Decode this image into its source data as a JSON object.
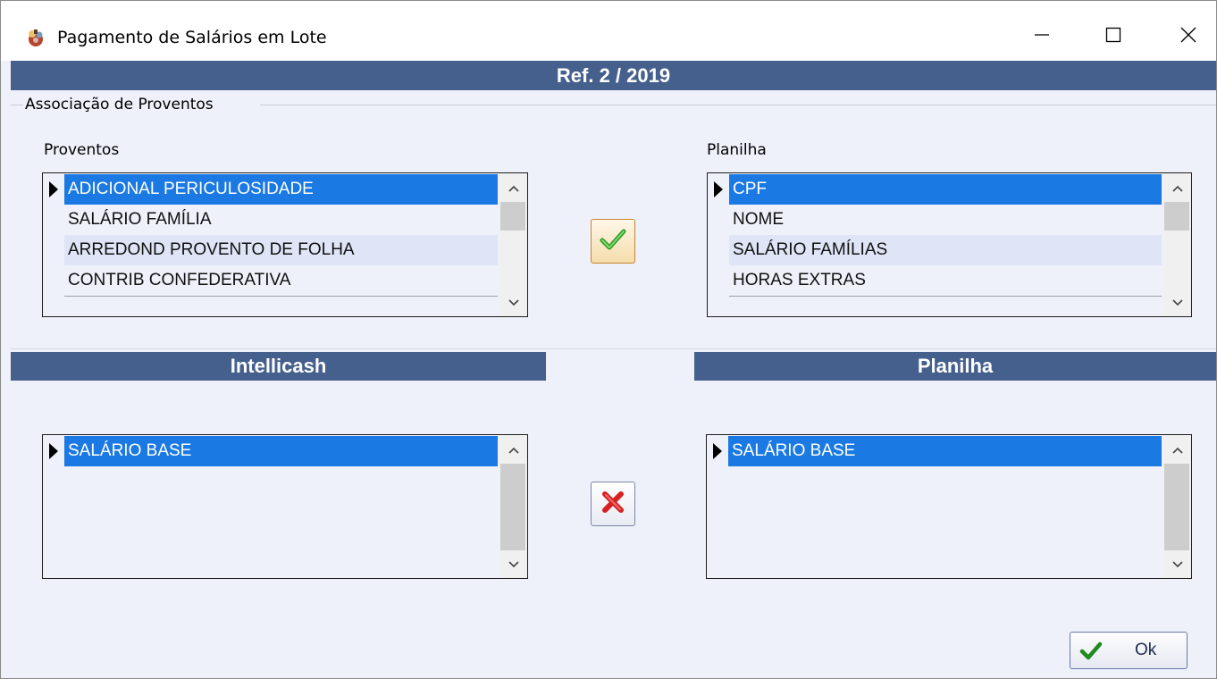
{
  "window": {
    "title": "Pagamento de Salários em Lote",
    "app_icon": "cash-bag-icon",
    "controls": [
      "minimize-icon",
      "maximize-icon",
      "close-icon"
    ]
  },
  "reference_header": "Ref. 2 / 2019",
  "association_group": {
    "title": "Associação de Proventos",
    "proventos": {
      "label": "Proventos",
      "items": [
        "ADICIONAL PERICULOSIDADE",
        "SALÁRIO FAMÍLIA",
        "ARREDOND PROVENTO DE FOLHA",
        "CONTRIB CONFEDERATIVA"
      ],
      "selected": "ADICIONAL PERICULOSIDADE"
    },
    "planilha": {
      "label": "Planilha",
      "items": [
        "CPF",
        "NOME",
        "SALÁRIO FAMÍLIAS",
        "HORAS EXTRAS"
      ],
      "selected": "CPF"
    },
    "associate_button_icon": "green-check-icon"
  },
  "mapped": {
    "intellicash_header": "Intellicash",
    "planilha_header": "Planilha",
    "intellicash_items": [
      "SALÁRIO BASE"
    ],
    "planilha_items": [
      "SALÁRIO BASE"
    ],
    "remove_button_icon": "red-x-icon"
  },
  "ok_button": {
    "label": "Ok",
    "icon": "green-check-icon"
  },
  "colors": {
    "header_bg": "#46608e",
    "selection": "#1a79e3",
    "window_bg": "#eef1fa"
  }
}
